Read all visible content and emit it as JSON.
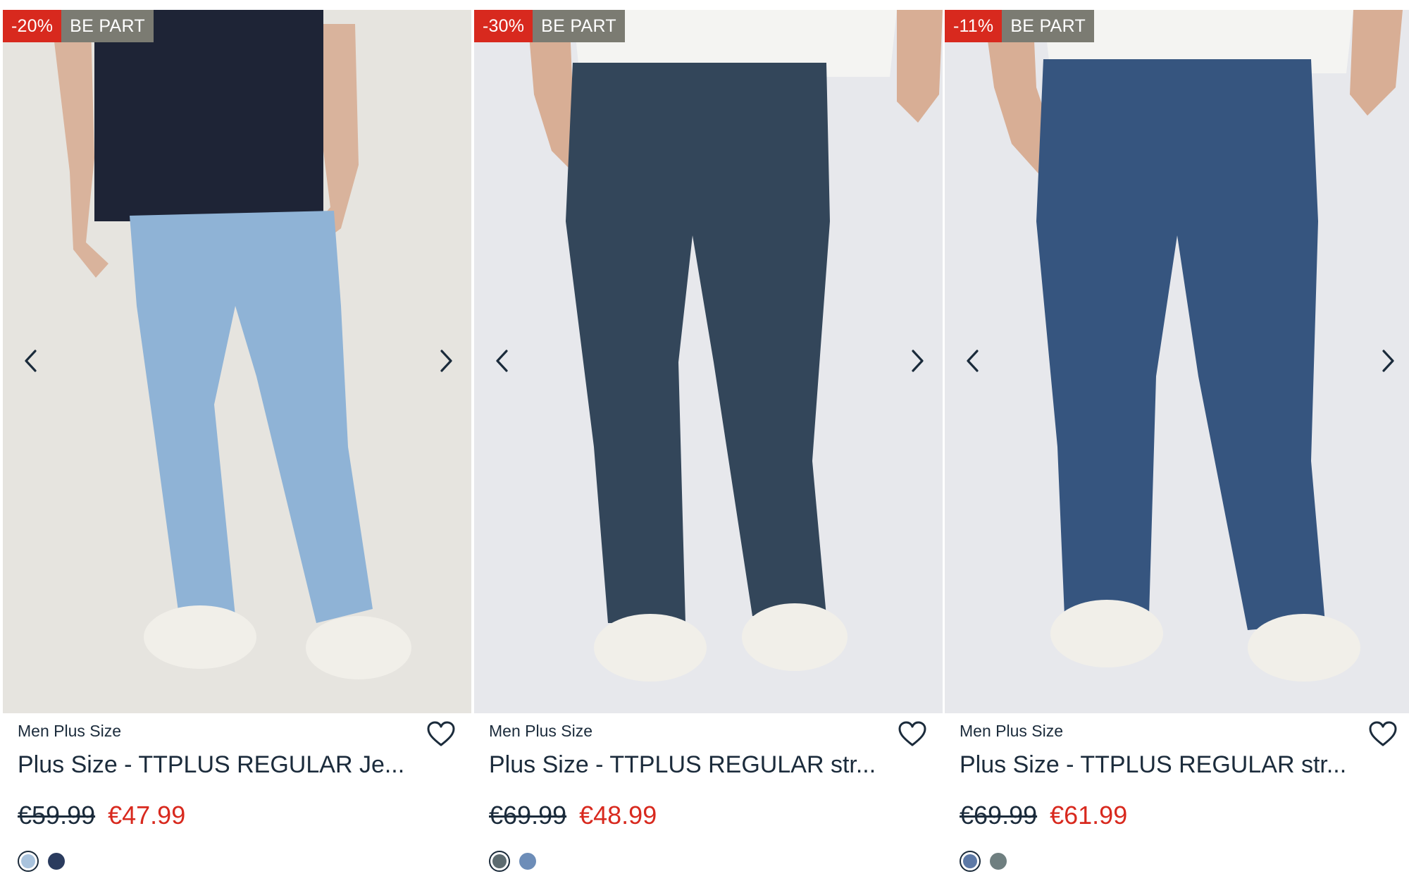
{
  "products": [
    {
      "discount_badge": "-20%",
      "campaign_badge": "BE PART",
      "brand": "Men Plus Size",
      "title": "Plus Size - TTPLUS REGULAR Je...",
      "old_price": "€59.99",
      "new_price": "€47.99",
      "image": {
        "background": "#e6e4df",
        "shirt": "#1e2436",
        "jeans": "#8fb3d6",
        "shoes": "#f1efe9",
        "skin": "#d9b39c"
      },
      "swatches": [
        {
          "color": "#a9c3dd",
          "selected": true
        },
        {
          "color": "#2a3b5e",
          "selected": false
        }
      ]
    },
    {
      "discount_badge": "-30%",
      "campaign_badge": "BE PART",
      "brand": "Men Plus Size",
      "title": "Plus Size - TTPLUS REGULAR str...",
      "old_price": "€69.99",
      "new_price": "€48.99",
      "image": {
        "background": "#e7e8ec",
        "shirt": "#f4f4f2",
        "jeans": "#33465a",
        "shoes": "#f1efe9",
        "skin": "#d8ae95"
      },
      "swatches": [
        {
          "color": "#5d6b70",
          "selected": true
        },
        {
          "color": "#6d8db8",
          "selected": false
        }
      ]
    },
    {
      "discount_badge": "-11%",
      "campaign_badge": "BE PART",
      "brand": "Men Plus Size",
      "title": "Plus Size - TTPLUS REGULAR str...",
      "old_price": "€69.99",
      "new_price": "€61.99",
      "image": {
        "background": "#e7e8ec",
        "shirt": "#f4f4f2",
        "jeans": "#36557f",
        "shoes": "#f1efe9",
        "skin": "#d8ae95"
      },
      "swatches": [
        {
          "color": "#5d79a6",
          "selected": true
        },
        {
          "color": "#6f7f80",
          "selected": false
        }
      ]
    }
  ],
  "icons": {
    "prev": "chevron-left-icon",
    "next": "chevron-right-icon",
    "wishlist": "heart-outline-icon"
  },
  "colors": {
    "sale": "#d8291e",
    "campaign": "#7b7b72",
    "text": "#1b2b3b"
  }
}
